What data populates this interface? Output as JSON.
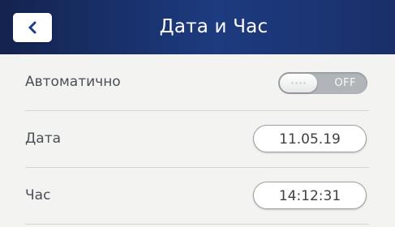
{
  "header": {
    "title": "Дата и Час",
    "back_icon": "chevron-left-icon",
    "background_color": "#1d3b80",
    "icon_color": "#1e3d86"
  },
  "settings": {
    "automatic": {
      "label": "Автоматично",
      "toggle_state": "OFF"
    },
    "date": {
      "label": "Дата",
      "value": "11.05.19"
    },
    "time": {
      "label": "Час",
      "value": "14:12:31"
    }
  }
}
